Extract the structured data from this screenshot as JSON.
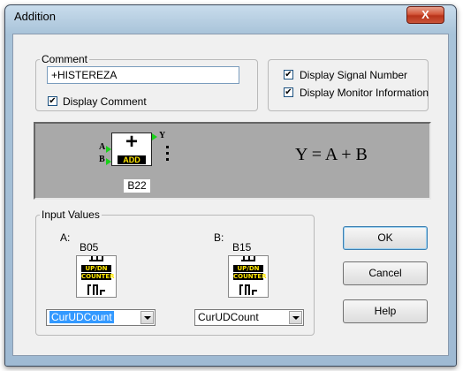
{
  "window": {
    "title": "Addition",
    "close_glyph": "X"
  },
  "comment_group": {
    "legend": "Comment",
    "value": "+HISTEREZA",
    "display_comment_label": "Display Comment",
    "display_comment_checked": true
  },
  "options": {
    "display_signal_number_label": "Display Signal Number",
    "display_signal_number_checked": true,
    "display_monitor_info_label": "Display Monitor Information",
    "display_monitor_info_checked": true
  },
  "preview": {
    "block_symbol": "+",
    "block_name": "ADD",
    "input_a": "A",
    "input_b": "B",
    "output_y": "Y",
    "block_id": "B22",
    "formula": "Y = A + B"
  },
  "input_values": {
    "legend": "Input Values",
    "a": {
      "label": "A:",
      "block": "B05",
      "counter_top": "UP/DN",
      "counter_bottom": "COUNTER",
      "selected": "CurUDCount"
    },
    "b": {
      "label": "B:",
      "block": "B15",
      "counter_top": "UP/DN",
      "counter_bottom": "COUNTER",
      "selected": "CurUDCount"
    }
  },
  "buttons": {
    "ok": "OK",
    "cancel": "Cancel",
    "help": "Help"
  }
}
